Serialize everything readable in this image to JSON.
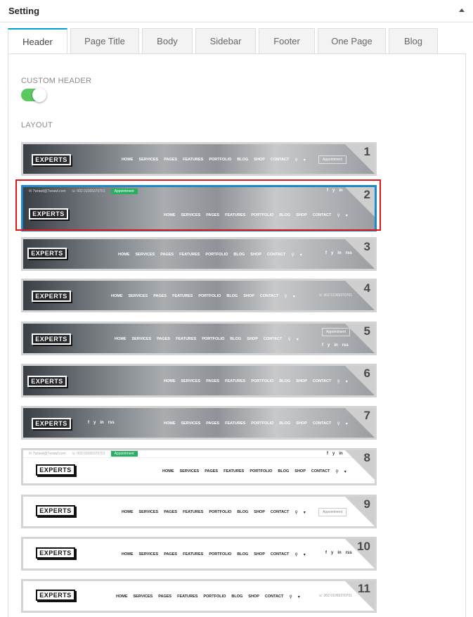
{
  "panel": {
    "title": "Setting"
  },
  "tabs": [
    "Header",
    "Page Title",
    "Body",
    "Sidebar",
    "Footer",
    "One Page",
    "Blog"
  ],
  "fields": {
    "custom_header_label": "CUSTOM HEADER",
    "layout_label": "LAYOUT"
  },
  "custom_header_enabled": true,
  "colors": {
    "accent": "#00a0d2",
    "switch_on": "#5cc860",
    "selected_border": "#1e88c8",
    "highlight": "#e0161b"
  },
  "brand": "EXPERTS",
  "nav_items": [
    "HOME",
    "SERVICES",
    "PAGES",
    "FEATURES",
    "PORTFOLIO",
    "BLOG",
    "SHOP",
    "CONTACT"
  ],
  "topbar": {
    "email": "7wrawl@7wrawl.com",
    "phone": "002 01065370701",
    "appointment": "Appointment"
  },
  "phone_short": "002 01065370701",
  "appointment_btn": "Appointment",
  "social_icons": [
    "f",
    "y",
    "in",
    "rss"
  ],
  "selected_layout": 2,
  "layouts": [
    {
      "number": "1"
    },
    {
      "number": "2"
    },
    {
      "number": "3"
    },
    {
      "number": "4"
    },
    {
      "number": "5"
    },
    {
      "number": "6"
    },
    {
      "number": "7"
    },
    {
      "number": "8"
    },
    {
      "number": "9"
    },
    {
      "number": "10"
    },
    {
      "number": "11"
    }
  ]
}
